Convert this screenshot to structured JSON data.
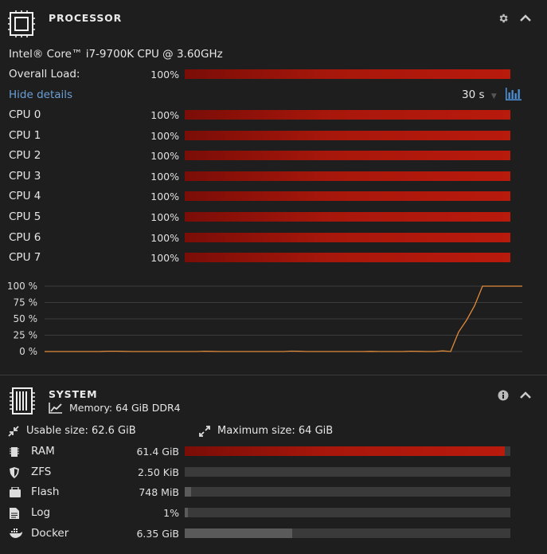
{
  "processor": {
    "title": "PROCESSOR",
    "model": "Intel® Core™ i7-9700K CPU @ 3.60GHz",
    "overall_label": "Overall Load:",
    "overall_value": "100%",
    "overall_fraction": 1.0,
    "hide_details": "Hide details",
    "interval": "30 s",
    "cpus": [
      {
        "label": "CPU 0",
        "value": "100%",
        "fraction": 1.0
      },
      {
        "label": "CPU 1",
        "value": "100%",
        "fraction": 1.0
      },
      {
        "label": "CPU 2",
        "value": "100%",
        "fraction": 1.0
      },
      {
        "label": "CPU 3",
        "value": "100%",
        "fraction": 1.0
      },
      {
        "label": "CPU 4",
        "value": "100%",
        "fraction": 1.0
      },
      {
        "label": "CPU 5",
        "value": "100%",
        "fraction": 1.0
      },
      {
        "label": "CPU 6",
        "value": "100%",
        "fraction": 1.0
      },
      {
        "label": "CPU 7",
        "value": "100%",
        "fraction": 1.0
      }
    ]
  },
  "chart_data": {
    "type": "line",
    "title": "",
    "xlabel": "",
    "ylabel": "",
    "yticks": [
      "100 %",
      "75 %",
      "50 %",
      "25 %",
      "0 %"
    ],
    "ylim": [
      0,
      100
    ],
    "series": [
      {
        "color": "#e08a3c",
        "x": [
          0,
          1,
          2,
          3,
          4,
          5,
          6,
          7,
          8,
          9,
          10,
          11,
          12,
          13,
          14,
          15,
          16,
          17,
          18,
          19,
          20,
          21,
          22,
          23,
          24,
          25,
          26,
          27,
          28,
          29,
          30,
          31,
          32,
          33,
          34,
          35,
          36,
          37,
          38,
          39,
          40,
          41,
          42,
          43,
          44,
          45,
          46,
          47,
          48,
          49,
          50,
          51,
          52,
          53,
          54,
          55,
          56,
          57,
          58,
          59,
          60
        ],
        "values": [
          0,
          0,
          0,
          0,
          0,
          0,
          0,
          0,
          0.5,
          0.5,
          0.3,
          0,
          0,
          0,
          0,
          0,
          0,
          0,
          0,
          0,
          0.4,
          0.3,
          0,
          0,
          0,
          0,
          0,
          0,
          0,
          0,
          0,
          0.6,
          0.4,
          0,
          0,
          0,
          0,
          0,
          0,
          0,
          0,
          0.3,
          0,
          0,
          0,
          0,
          0.5,
          0.3,
          0,
          0,
          1,
          0,
          30,
          48,
          70,
          100,
          100,
          100,
          100,
          100,
          100
        ]
      }
    ]
  },
  "system": {
    "title": "SYSTEM",
    "memory": "Memory: 64 GiB DDR4",
    "usable": "Usable size: 62.6 GiB",
    "maximum": "Maximum size: 64 GiB",
    "rows": [
      {
        "label": "RAM",
        "value": "61.4 GiB",
        "fraction": 0.982,
        "style": "red",
        "icon": "chip-icon"
      },
      {
        "label": "ZFS",
        "value": "2.50 KiB",
        "fraction": 0.0,
        "style": "gray",
        "icon": "shield-icon"
      },
      {
        "label": "Flash",
        "value": "748 MiB",
        "fraction": 0.02,
        "style": "gray",
        "icon": "usb-icon"
      },
      {
        "label": "Log",
        "value": "1%",
        "fraction": 0.01,
        "style": "gray",
        "icon": "document-icon"
      },
      {
        "label": "Docker",
        "value": "6.35 GiB",
        "fraction": 0.33,
        "style": "gray",
        "icon": "docker-icon"
      }
    ]
  },
  "colors": {
    "accent": "#6a9fd6",
    "bar_red": "#b81a0c",
    "line": "#e08a3c"
  }
}
